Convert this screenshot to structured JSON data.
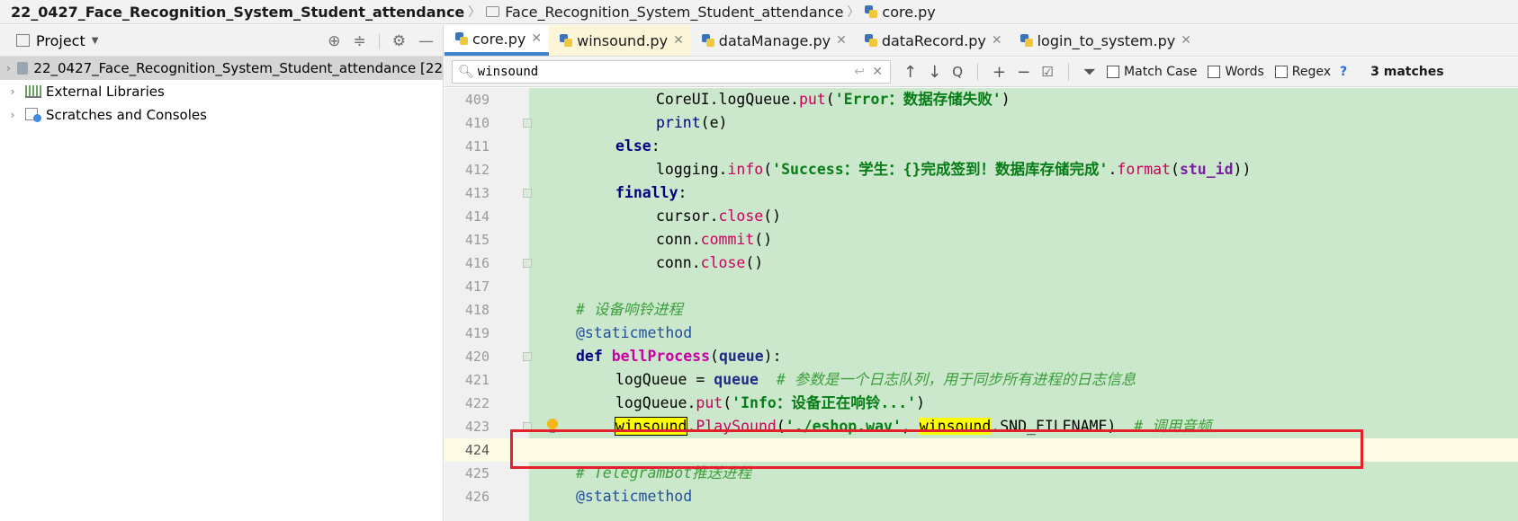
{
  "breadcrumb": {
    "project": "22_0427_Face_Recognition_System_Student_attendance",
    "folder": "Face_Recognition_System_Student_attendance",
    "file": "core.py"
  },
  "project_panel": {
    "title": "Project",
    "items": [
      {
        "label": "22_0427_Face_Recognition_System_Student_attendance [22"
      },
      {
        "label": "External Libraries"
      },
      {
        "label": "Scratches and Consoles"
      }
    ]
  },
  "tabs": [
    {
      "label": "core.py"
    },
    {
      "label": "winsound.py"
    },
    {
      "label": "dataManage.py"
    },
    {
      "label": "dataRecord.py"
    },
    {
      "label": "login_to_system.py"
    }
  ],
  "search": {
    "value": "winsound",
    "match_case": "Match Case",
    "words": "Words",
    "regex": "Regex",
    "help": "?",
    "matches": "3 matches"
  },
  "lines": {
    "409": "409",
    "410": "410",
    "411": "411",
    "412": "412",
    "413": "413",
    "414": "414",
    "415": "415",
    "416": "416",
    "417": "417",
    "418": "418",
    "419": "419",
    "420": "420",
    "421": "421",
    "422": "422",
    "423": "423",
    "424": "424",
    "425": "425",
    "426": "426"
  },
  "code": {
    "l409_obj": "CoreUI.logQueue.",
    "l409_fn": "put",
    "l409_str": "'Error：数据存储失败'",
    "l410_fn": "print",
    "l410_rest": "(e)",
    "l411_kw": "else",
    "l412_obj": "logging.",
    "l412_fn": "info",
    "l412_str": "'Success：学生：{}完成签到！数据库存储完成'",
    "l412_fn2": "format",
    "l412_arg": "stu_id",
    "l413_kw": "finally",
    "l414_obj": "cursor.",
    "l414_fn": "close",
    "l415_obj": "conn.",
    "l415_fn": "commit",
    "l416_obj": "conn.",
    "l416_fn": "close",
    "l418_cm": "# 设备响铃进程",
    "l419_dec": "@staticmethod",
    "l420_kw": "def",
    "l420_name": "bellProcess",
    "l420_par": "queue",
    "l421_lhs": "logQueue = ",
    "l421_par": "queue",
    "l421_cm": "# 参数是一个日志队列，用于同步所有进程的日志信息",
    "l422_obj": "logQueue.",
    "l422_fn": "put",
    "l422_str": "'Info：设备正在响铃...'",
    "l423_mod": "winsound",
    "l423_fn": "PlaySound",
    "l423_str": "'./eshop.wav'",
    "l423_mod2": "winsound",
    "l423_const": ".SND_FILENAME)",
    "l423_cm": "# 调用音频",
    "l425_cm": "# TelegramBot推送进程",
    "l426_dec": "@staticmethod"
  }
}
